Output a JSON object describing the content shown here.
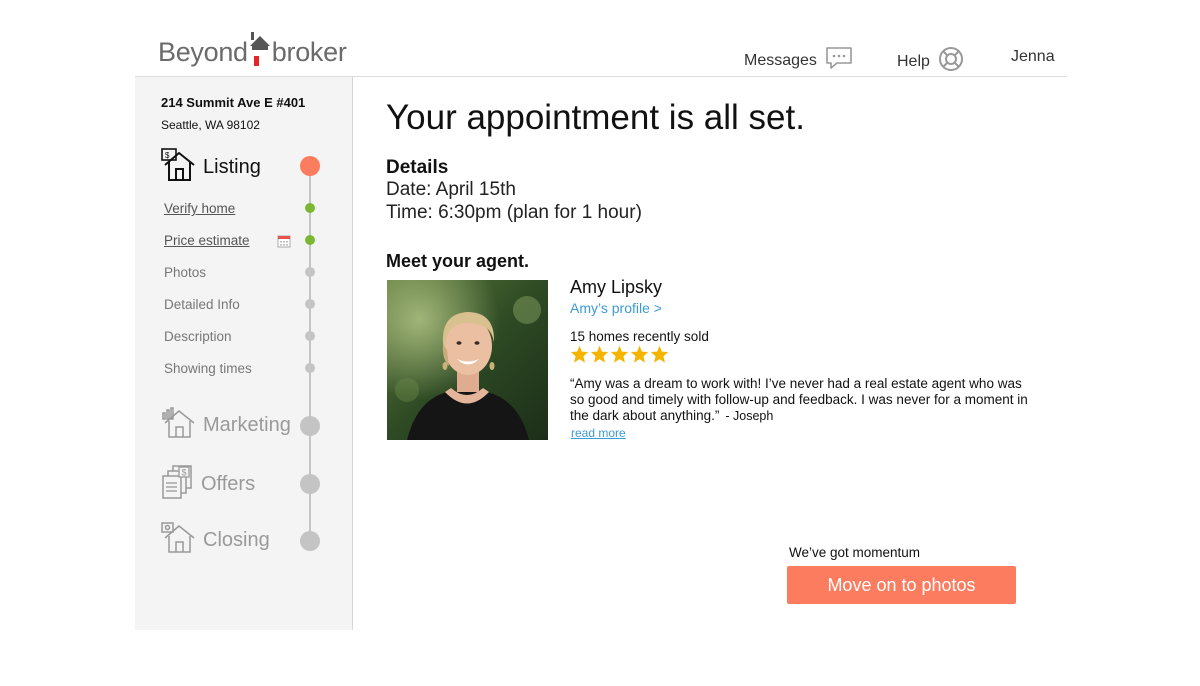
{
  "header": {
    "logo_left": "Beyond",
    "logo_right": "broker",
    "messages_label": "Messages",
    "help_label": "Help",
    "user_name": "Jenna"
  },
  "sidebar": {
    "address_line1": "214 Summit Ave E #401",
    "address_line2": "Seattle, WA 98102",
    "stages": [
      {
        "label": "Listing",
        "icon": "house-icon",
        "status": "active"
      },
      {
        "label": "Marketing",
        "icon": "house-chart-icon",
        "status": "upcoming"
      },
      {
        "label": "Offers",
        "icon": "documents-dollar-icon",
        "status": "upcoming"
      },
      {
        "label": "Closing",
        "icon": "house-key-icon",
        "status": "upcoming"
      }
    ],
    "listing_steps": [
      {
        "label": "Verify home",
        "status": "done"
      },
      {
        "label": "Price estimate",
        "status": "done"
      },
      {
        "label": "Photos",
        "status": "pending"
      },
      {
        "label": "Detailed Info",
        "status": "pending"
      },
      {
        "label": "Description",
        "status": "pending"
      },
      {
        "label": "Showing times",
        "status": "pending"
      }
    ]
  },
  "main": {
    "headline": "Your appointment is all set.",
    "details_heading": "Details",
    "date_line": "Date: April 15th",
    "time_line": "Time: 6:30pm (plan for 1 hour)",
    "meet_heading": "Meet your agent.",
    "agent": {
      "name": "Amy Lipsky",
      "profile_link": "Amy’s profile >",
      "homes_sold": "15 homes recently sold",
      "rating": 5,
      "quote": "“Amy was a dream to work with! I’ve never had a real estate agent who was so good and timely with follow-up and feedback. I was never for a moment in the dark about anything.”",
      "quote_author": "- Joseph",
      "read_more": "read more"
    }
  },
  "footer_cta": {
    "caption": "We’ve got momentum",
    "button_label": "Move on to photos"
  },
  "colors": {
    "accent": "#fb7c5f",
    "done_green": "#7cb82f",
    "link_blue": "#3b9ad9",
    "star_gold": "#f4b400",
    "pending_gray": "#c4c4c4"
  }
}
